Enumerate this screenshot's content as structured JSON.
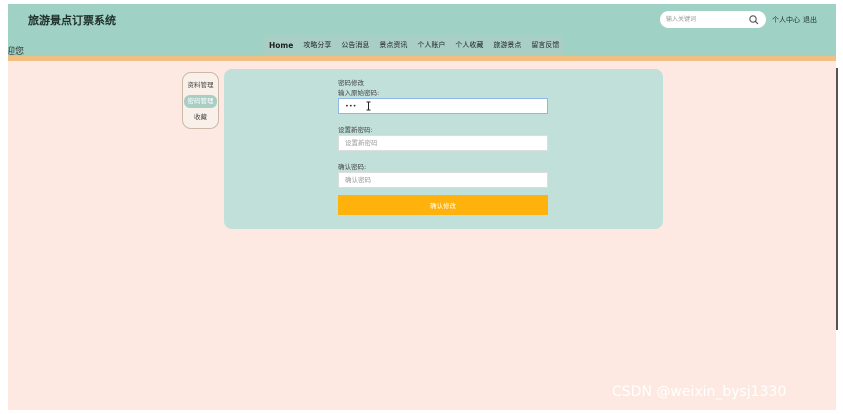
{
  "header": {
    "site_title": "旅游景点订票系统",
    "marquee_text": "迎您",
    "search_placeholder": "输入关键词",
    "user_center": "个人中心",
    "logout": "退出"
  },
  "nav": {
    "items": [
      "Home",
      "攻略分享",
      "公告消息",
      "景点资讯",
      "个人账户",
      "个人收藏",
      "旅游景点",
      "留言反馈"
    ]
  },
  "side_menu": {
    "items": [
      {
        "label": "资料管理",
        "active": false
      },
      {
        "label": "密码管理",
        "active": true
      },
      {
        "label": "收藏",
        "active": false
      }
    ]
  },
  "form": {
    "title": "密码修改",
    "old_password_label": "输入原始密码:",
    "old_password_value": "•••",
    "new_password_label": "设置新密码:",
    "new_password_placeholder": "设置新密码",
    "confirm_password_label": "确认密码:",
    "confirm_password_placeholder": "确认密码",
    "submit_label": "确认修改"
  },
  "watermark": "CSDN @weixin_bysj1330",
  "colors": {
    "header_bg": "#9fd1c4",
    "page_bg": "#fde9e1",
    "panel_bg": "#c1e0d9",
    "accent_strip": "#f2bf82",
    "button_bg": "#ffb20c"
  },
  "icons": {
    "search": "search-icon",
    "cursor": "text-cursor-icon"
  }
}
